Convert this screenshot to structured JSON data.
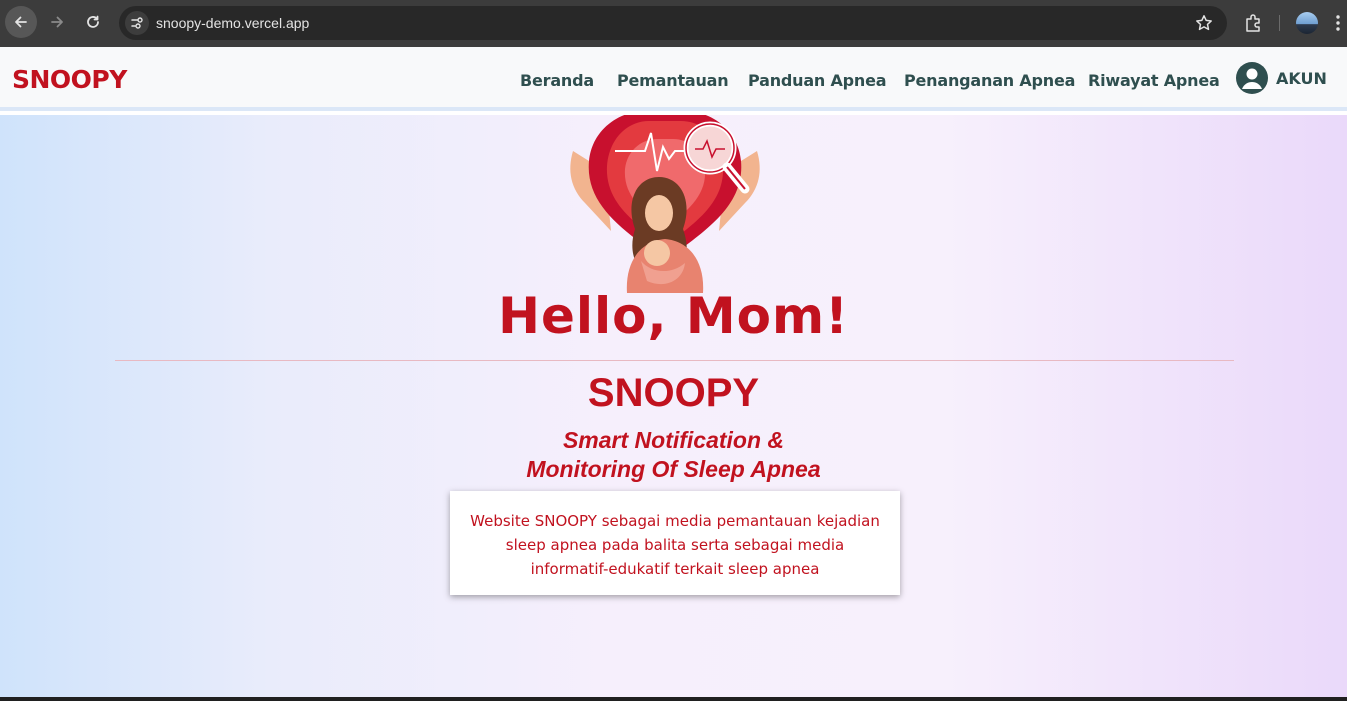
{
  "browser": {
    "url": "snoopy-demo.vercel.app"
  },
  "header": {
    "logo": "SNOOPY",
    "nav": [
      {
        "label": "Beranda"
      },
      {
        "label": "Pemantauan"
      },
      {
        "label": "Panduan Apnea"
      },
      {
        "label": "Penanganan Apnea"
      },
      {
        "label": "Riwayat Apnea"
      }
    ],
    "account_label": "AKUN"
  },
  "hero": {
    "greeting": "Hello, Mom!",
    "title": "SNOOPY",
    "subtitle_line1": "Smart Notification &",
    "subtitle_line2": "Monitoring Of Sleep Apnea",
    "description": "Website SNOOPY sebagai media pemantauan kejadian sleep apnea pada balita serta sebagai media informatif-edukatif terkait sleep apnea"
  },
  "colors": {
    "brand_red": "#c1121f",
    "nav_text": "#2f4f4f",
    "header_bg": "#f8f9fa"
  },
  "icons": [
    "back-arrow-icon",
    "forward-arrow-icon",
    "reload-icon",
    "site-info-icon",
    "star-icon",
    "extensions-icon",
    "profile-icon",
    "menu-dots-icon",
    "account-icon",
    "mother-heart-illustration"
  ]
}
